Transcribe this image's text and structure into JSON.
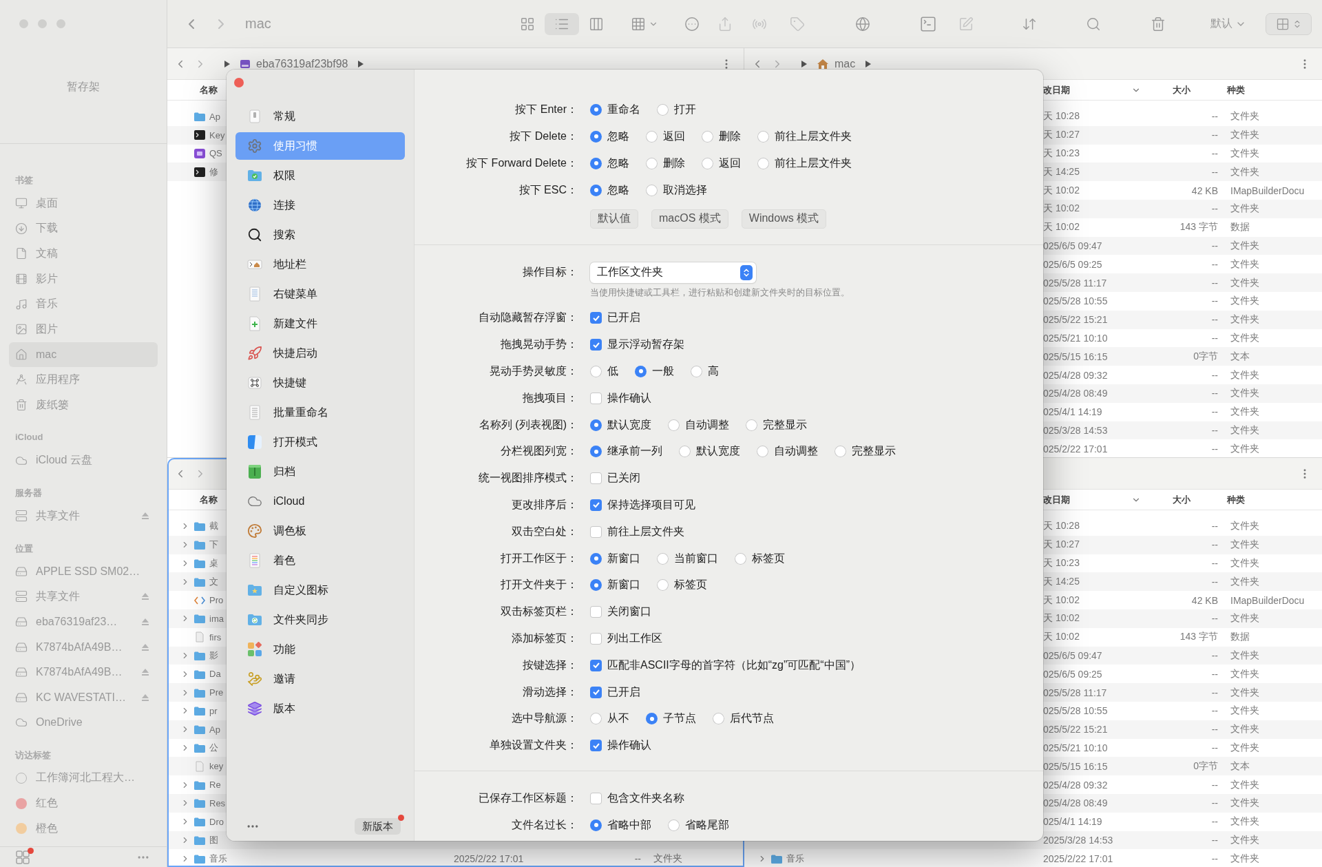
{
  "sidebar": {
    "shelf_title": "暂存架",
    "sections": [
      {
        "heading": "书签",
        "items": [
          {
            "label": "桌面",
            "kind": "place",
            "selected": false,
            "ejectable": false
          },
          {
            "label": "下载",
            "kind": "place",
            "selected": false,
            "ejectable": false
          },
          {
            "label": "文稿",
            "kind": "place",
            "selected": false,
            "ejectable": false
          },
          {
            "label": "影片",
            "kind": "place",
            "selected": false,
            "ejectable": false
          },
          {
            "label": "音乐",
            "kind": "place",
            "selected": false,
            "ejectable": false
          },
          {
            "label": "图片",
            "kind": "place",
            "selected": false,
            "ejectable": false
          },
          {
            "label": "mac",
            "kind": "place",
            "selected": true,
            "ejectable": false
          },
          {
            "label": "应用程序",
            "kind": "place",
            "selected": false,
            "ejectable": false
          },
          {
            "label": "废纸篓",
            "kind": "place",
            "selected": false,
            "ejectable": false
          }
        ]
      },
      {
        "heading": "iCloud",
        "items": [
          {
            "label": "iCloud 云盘",
            "kind": "place",
            "selected": false,
            "ejectable": false
          }
        ]
      },
      {
        "heading": "服务器",
        "items": [
          {
            "label": "共享文件",
            "kind": "place",
            "selected": false,
            "ejectable": true
          }
        ]
      },
      {
        "heading": "位置",
        "items": [
          {
            "label": "APPLE SSD SM02…",
            "kind": "place",
            "selected": false,
            "ejectable": false
          },
          {
            "label": "共享文件",
            "kind": "place",
            "selected": false,
            "ejectable": true
          },
          {
            "label": "eba76319af23…",
            "kind": "place",
            "selected": false,
            "ejectable": true
          },
          {
            "label": "K7874bAfA49B…",
            "kind": "place",
            "selected": false,
            "ejectable": true
          },
          {
            "label": "K7874bAfA49B…",
            "kind": "place",
            "selected": false,
            "ejectable": true
          },
          {
            "label": "KC WAVESTATI…",
            "kind": "place",
            "selected": false,
            "ejectable": true
          },
          {
            "label": "OneDrive",
            "kind": "place",
            "selected": false,
            "ejectable": false
          }
        ]
      },
      {
        "heading": "访达标签",
        "items": [
          {
            "label": "工作簿河北工程大…",
            "kind": "tag",
            "selected": false,
            "ejectable": false
          },
          {
            "label": "红色",
            "kind": "tag",
            "color": "#e9a3a3",
            "selected": false,
            "ejectable": false
          },
          {
            "label": "橙色",
            "kind": "tag",
            "color": "#f2cd9f",
            "selected": false,
            "ejectable": false
          }
        ]
      }
    ],
    "bottom_badge": true
  },
  "toolbar": {
    "title": "mac",
    "view_modes": [
      {
        "selected": false
      },
      {
        "selected": true
      },
      {
        "selected": false
      }
    ],
    "sort_label": "默认"
  },
  "panes": [
    {
      "focused": false,
      "path": {
        "show_nav": true,
        "show_menu": true,
        "crumbs": [
          {
            "label": "eba76319af23bf98",
            "kind": "disk"
          }
        ]
      },
      "columns": [
        {
          "label": "名称",
          "kind": "name",
          "sorted": false
        }
      ],
      "rows": [
        {
          "name": "Ap",
          "kind": "folder"
        },
        {
          "name": "Key",
          "kind": "exec"
        },
        {
          "name": "QS",
          "kind": "app"
        },
        {
          "name": "修",
          "kind": "exec"
        }
      ]
    },
    {
      "focused": false,
      "path": {
        "show_nav": true,
        "show_menu": true,
        "crumbs": [
          {
            "label": "mac",
            "kind": "home"
          }
        ]
      },
      "columns": [
        {
          "label": "改日期",
          "kind": "date",
          "sorted": true
        },
        {
          "label": "大小",
          "kind": "size",
          "sorted": false
        },
        {
          "label": "种类",
          "kind": "type",
          "sorted": false
        }
      ],
      "rows": [
        {
          "date": "天 10:28",
          "size": "--",
          "type": "文件夹"
        },
        {
          "date": "天 10:27",
          "size": "--",
          "type": "文件夹"
        },
        {
          "date": "天 10:23",
          "size": "--",
          "type": "文件夹"
        },
        {
          "date": "天 14:25",
          "size": "--",
          "type": "文件夹"
        },
        {
          "date": "天 10:02",
          "size": "42 KB",
          "type": "IMapBuilderDocu"
        },
        {
          "date": "天 10:02",
          "size": "--",
          "type": "文件夹"
        },
        {
          "date": "天 10:02",
          "size": "143 字节",
          "type": "数据"
        },
        {
          "date": "025/6/5 09:47",
          "size": "--",
          "type": "文件夹"
        },
        {
          "date": "025/6/5 09:25",
          "size": "--",
          "type": "文件夹"
        },
        {
          "date": "025/5/28 11:17",
          "size": "--",
          "type": "文件夹"
        },
        {
          "date": "025/5/28 10:55",
          "size": "--",
          "type": "文件夹"
        },
        {
          "date": "025/5/22 15:21",
          "size": "--",
          "type": "文件夹"
        },
        {
          "date": "025/5/21 10:10",
          "size": "--",
          "type": "文件夹"
        },
        {
          "date": "025/5/15 16:15",
          "size": "0字节",
          "type": "文本"
        },
        {
          "date": "025/4/28 09:32",
          "size": "--",
          "type": "文件夹"
        },
        {
          "date": "025/4/28 08:49",
          "size": "--",
          "type": "文件夹"
        },
        {
          "date": "025/4/1 14:19",
          "size": "--",
          "type": "文件夹"
        },
        {
          "date": "025/3/28 14:53",
          "size": "--",
          "type": "文件夹"
        },
        {
          "date": "025/2/22 17:01",
          "size": "--",
          "type": "文件夹"
        }
      ]
    },
    {
      "focused": true,
      "path": {
        "show_nav": true,
        "show_menu": false
      },
      "columns": [
        {
          "label": "名称",
          "kind": "name",
          "sorted": false
        }
      ],
      "rows": [
        {
          "name": "截",
          "kind": "folder",
          "expanded": false
        },
        {
          "name": "下",
          "kind": "folder",
          "expanded": false
        },
        {
          "name": "桌",
          "kind": "folder",
          "expanded": false
        },
        {
          "name": "文",
          "kind": "folder",
          "expanded": false
        },
        {
          "name": "Pro",
          "kind": "script"
        },
        {
          "name": "ima",
          "kind": "folder",
          "expanded": false
        },
        {
          "name": "firs",
          "kind": "doc"
        },
        {
          "name": "影",
          "kind": "folder",
          "expanded": false
        },
        {
          "name": "Da",
          "kind": "folder",
          "expanded": false
        },
        {
          "name": "Pre",
          "kind": "folder",
          "expanded": false
        },
        {
          "name": "pr",
          "kind": "folder",
          "expanded": false
        },
        {
          "name": "Ap",
          "kind": "folder",
          "expanded": false
        },
        {
          "name": "公",
          "kind": "folder",
          "expanded": false
        },
        {
          "name": "key",
          "kind": "doc"
        },
        {
          "name": "Re",
          "kind": "folder",
          "expanded": false
        },
        {
          "name": "Res",
          "kind": "folder",
          "expanded": false
        },
        {
          "name": "Dro",
          "kind": "folder",
          "expanded": false
        },
        {
          "name": "图",
          "kind": "folder",
          "expanded": false
        },
        {
          "name": "音乐",
          "kind": "folder",
          "expanded": false,
          "date": "2025/2/22 17:01",
          "size": "--",
          "type": "文件夹"
        }
      ]
    },
    {
      "focused": false,
      "path": {
        "show_nav": false,
        "show_menu": true
      },
      "columns": [
        {
          "label": "改日期",
          "kind": "date",
          "sorted": true
        },
        {
          "label": "大小",
          "kind": "size",
          "sorted": false
        },
        {
          "label": "种类",
          "kind": "type",
          "sorted": false
        }
      ],
      "rows": [
        {
          "date": "天 10:28",
          "size": "--",
          "type": "文件夹"
        },
        {
          "date": "天 10:27",
          "size": "--",
          "type": "文件夹"
        },
        {
          "date": "天 10:23",
          "size": "--",
          "type": "文件夹"
        },
        {
          "date": "天 14:25",
          "size": "--",
          "type": "文件夹"
        },
        {
          "date": "天 10:02",
          "size": "42 KB",
          "type": "IMapBuilderDocu"
        },
        {
          "date": "天 10:02",
          "size": "--",
          "type": "文件夹"
        },
        {
          "date": "天 10:02",
          "size": "143 字节",
          "type": "数据"
        },
        {
          "date": "025/6/5 09:47",
          "size": "--",
          "type": "文件夹"
        },
        {
          "date": "025/6/5 09:25",
          "size": "--",
          "type": "文件夹"
        },
        {
          "date": "025/5/28 11:17",
          "size": "--",
          "type": "文件夹"
        },
        {
          "date": "025/5/28 10:55",
          "size": "--",
          "type": "文件夹"
        },
        {
          "date": "025/5/22 15:21",
          "size": "--",
          "type": "文件夹"
        },
        {
          "date": "025/5/21 10:10",
          "size": "--",
          "type": "文件夹"
        },
        {
          "date": "025/5/15 16:15",
          "size": "0字节",
          "type": "文本"
        },
        {
          "date": "025/4/28 09:32",
          "size": "--",
          "type": "文件夹"
        },
        {
          "date": "025/4/28 08:49",
          "size": "--",
          "type": "文件夹"
        },
        {
          "date": "025/4/1 14:19",
          "size": "--",
          "type": "文件夹"
        },
        {
          "date": "2025/3/28 14:53",
          "size": "--",
          "type": "文件夹"
        },
        {
          "name": "音乐",
          "kind": "folder",
          "expanded": false,
          "date": "2025/2/22 17:01",
          "size": "--",
          "type": "文件夹"
        }
      ]
    }
  ],
  "dialog": {
    "nav": [
      {
        "label": "常规",
        "selected": false
      },
      {
        "label": "使用习惯",
        "selected": true
      },
      {
        "label": "权限",
        "selected": false
      },
      {
        "label": "连接",
        "selected": false
      },
      {
        "label": "搜索",
        "selected": false
      },
      {
        "label": "地址栏",
        "selected": false
      },
      {
        "label": "右键菜单",
        "selected": false
      },
      {
        "label": "新建文件",
        "selected": false
      },
      {
        "label": "快捷启动",
        "selected": false
      },
      {
        "label": "快捷键",
        "selected": false
      },
      {
        "label": "批量重命名",
        "selected": false
      },
      {
        "label": "打开模式",
        "selected": false
      },
      {
        "label": "归档",
        "selected": false
      },
      {
        "label": "iCloud",
        "selected": false
      },
      {
        "label": "调色板",
        "selected": false
      },
      {
        "label": "着色",
        "selected": false
      },
      {
        "label": "自定义图标",
        "selected": false
      },
      {
        "label": "文件夹同步",
        "selected": false
      },
      {
        "label": "功能",
        "selected": false
      },
      {
        "label": "邀请",
        "selected": false
      },
      {
        "label": "版本",
        "selected": false
      }
    ],
    "update_button": "新版本",
    "update_badge": true,
    "sections": [
      {
        "rows": [
          {
            "label": "按下 Enter：",
            "kind": "radio",
            "options": [
              {
                "label": "重命名",
                "selected": true
              },
              {
                "label": "打开",
                "selected": false
              }
            ]
          },
          {
            "label": "按下 Delete：",
            "kind": "radio",
            "options": [
              {
                "label": "忽略",
                "selected": true
              },
              {
                "label": "返回",
                "selected": false
              },
              {
                "label": "删除",
                "selected": false
              },
              {
                "label": "前往上层文件夹",
                "selected": false
              }
            ]
          },
          {
            "label": "按下 Forward Delete：",
            "kind": "radio",
            "options": [
              {
                "label": "忽略",
                "selected": true
              },
              {
                "label": "删除",
                "selected": false
              },
              {
                "label": "返回",
                "selected": false
              },
              {
                "label": "前往上层文件夹",
                "selected": false
              }
            ]
          },
          {
            "label": "按下 ESC：",
            "kind": "radio",
            "options": [
              {
                "label": "忽略",
                "selected": true
              },
              {
                "label": "取消选择",
                "selected": false
              }
            ]
          },
          {
            "kind": "buttons",
            "buttons": [
              "默认值",
              "macOS 模式",
              "Windows 模式"
            ]
          }
        ]
      },
      {
        "rows": [
          {
            "label": "操作目标：",
            "kind": "select",
            "value": "工作区文件夹",
            "hint": "当使用快捷键或工具栏，进行粘贴和创建新文件夹时的目标位置。"
          },
          {
            "label": "自动隐藏暂存浮窗：",
            "kind": "checkbox",
            "options": [
              {
                "label": "已开启",
                "checked": true
              }
            ]
          },
          {
            "label": "拖拽晃动手势：",
            "kind": "checkbox",
            "options": [
              {
                "label": "显示浮动暂存架",
                "checked": true
              }
            ]
          },
          {
            "label": "晃动手势灵敏度：",
            "kind": "radio",
            "options": [
              {
                "label": "低",
                "selected": false
              },
              {
                "label": "一般",
                "selected": true
              },
              {
                "label": "高",
                "selected": false
              }
            ]
          },
          {
            "label": "拖拽项目：",
            "kind": "checkbox",
            "options": [
              {
                "label": "操作确认",
                "checked": false
              }
            ]
          },
          {
            "label": "名称列 (列表视图)：",
            "kind": "radio",
            "options": [
              {
                "label": "默认宽度",
                "selected": true
              },
              {
                "label": "自动调整",
                "selected": false
              },
              {
                "label": "完整显示",
                "selected": false
              }
            ]
          },
          {
            "label": "分栏视图列宽：",
            "kind": "radio",
            "options": [
              {
                "label": "继承前一列",
                "selected": true
              },
              {
                "label": "默认宽度",
                "selected": false
              },
              {
                "label": "自动调整",
                "selected": false
              },
              {
                "label": "完整显示",
                "selected": false
              }
            ]
          },
          {
            "label": "统一视图排序模式：",
            "kind": "checkbox",
            "options": [
              {
                "label": "已关闭",
                "checked": false
              }
            ]
          },
          {
            "label": "更改排序后：",
            "kind": "checkbox",
            "options": [
              {
                "label": "保持选择项目可见",
                "checked": true
              }
            ]
          },
          {
            "label": "双击空白处：",
            "kind": "checkbox",
            "options": [
              {
                "label": "前往上层文件夹",
                "checked": false
              }
            ]
          },
          {
            "label": "打开工作区于：",
            "kind": "radio",
            "options": [
              {
                "label": "新窗口",
                "selected": true
              },
              {
                "label": "当前窗口",
                "selected": false
              },
              {
                "label": "标签页",
                "selected": false
              }
            ]
          },
          {
            "label": "打开文件夹于：",
            "kind": "radio",
            "options": [
              {
                "label": "新窗口",
                "selected": true
              },
              {
                "label": "标签页",
                "selected": false
              }
            ]
          },
          {
            "label": "双击标签页栏：",
            "kind": "checkbox",
            "options": [
              {
                "label": "关闭窗口",
                "checked": false
              }
            ]
          },
          {
            "label": "添加标签页：",
            "kind": "checkbox",
            "options": [
              {
                "label": "列出工作区",
                "checked": false
              }
            ]
          },
          {
            "label": "按键选择：",
            "kind": "checkbox",
            "options": [
              {
                "label": "匹配非ASCII字母的首字符（比如“zg”可匹配“中国”）",
                "checked": true
              }
            ]
          },
          {
            "label": "滑动选择：",
            "kind": "checkbox",
            "options": [
              {
                "label": "已开启",
                "checked": true
              }
            ]
          },
          {
            "label": "选中导航源：",
            "kind": "radio",
            "options": [
              {
                "label": "从不",
                "selected": false
              },
              {
                "label": "子节点",
                "selected": true
              },
              {
                "label": "后代节点",
                "selected": false
              }
            ]
          },
          {
            "label": "单独设置文件夹：",
            "kind": "checkbox",
            "options": [
              {
                "label": "操作确认",
                "checked": true
              }
            ]
          }
        ]
      },
      {
        "rows": [
          {
            "label": "已保存工作区标题：",
            "kind": "checkbox",
            "options": [
              {
                "label": "包含文件夹名称",
                "checked": false
              }
            ]
          },
          {
            "label": "文件名过长：",
            "kind": "radio",
            "options": [
              {
                "label": "省略中部",
                "selected": true
              },
              {
                "label": "省略尾部",
                "selected": false
              }
            ]
          }
        ]
      }
    ]
  }
}
